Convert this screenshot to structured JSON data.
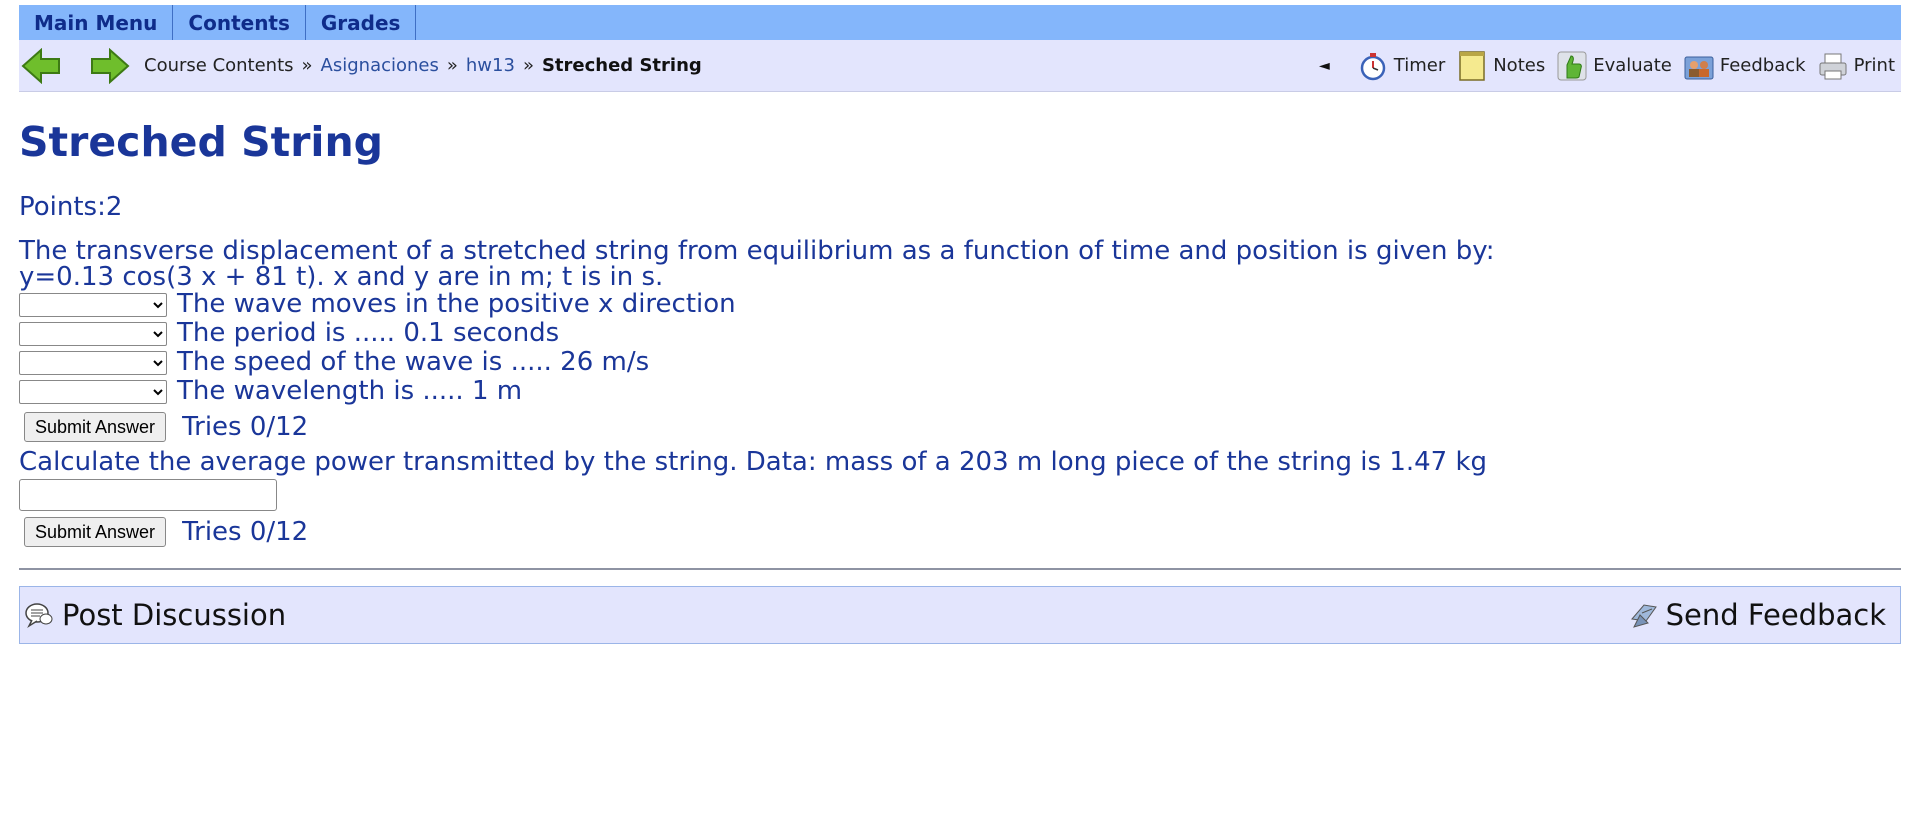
{
  "topbar": {
    "main_menu": "Main Menu",
    "contents": "Contents",
    "grades": "Grades"
  },
  "breadcrumb": {
    "course_contents": "Course Contents",
    "sep": "»",
    "assignments": "Asignaciones",
    "hw": "hw13",
    "current": "Streched String"
  },
  "tools": {
    "timer": "Timer",
    "notes": "Notes",
    "evaluate": "Evaluate",
    "feedback": "Feedback",
    "print": "Print",
    "collapse": "◄"
  },
  "page": {
    "title": "Streched String",
    "points": "Points:2"
  },
  "problem": {
    "intro": "The transverse displacement of a stretched string from equilibrium as a function of time and position is given by:",
    "equation": "y=0.13 cos(3 x + 81 t). x and y are in m; t is in s.",
    "statements": [
      "The wave moves in the positive x direction",
      "The period is ..... 0.1 seconds",
      "The speed of the wave is ..... 26 m/s",
      "The wavelength is ..... 1 m"
    ],
    "submit_label": "Submit Answer",
    "tries1": "Tries 0/12",
    "calc": "Calculate the average power transmitted by the string. Data: mass of a 203 m long piece of the string is 1.47 kg",
    "tries2": "Tries 0/12"
  },
  "footer": {
    "post": "Post Discussion",
    "send": "Send Feedback"
  }
}
